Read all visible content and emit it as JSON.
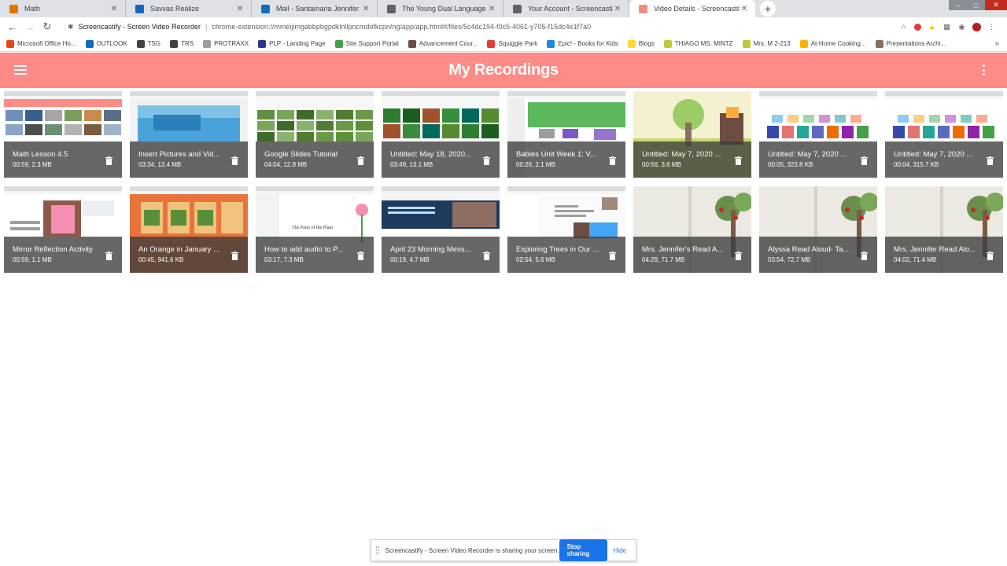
{
  "browser": {
    "tabs": [
      {
        "label": "Math",
        "color": "#e37400",
        "active": false
      },
      {
        "label": "Savvas Realize",
        "color": "#1565c0",
        "active": false
      },
      {
        "label": "Mail - Santamaria Jennifer - Outl",
        "color": "#0f6cbd",
        "active": false
      },
      {
        "label": "The Young Dual Language Learn",
        "color": "#5f6368",
        "active": false
      },
      {
        "label": "Your Account - Screencastify",
        "color": "#5f6368",
        "active": false
      },
      {
        "label": "Video Details - Screencastify",
        "color": "#f28b82",
        "active": true
      }
    ],
    "omnibox": {
      "site": "Screencastify - Screen Video Recorder",
      "url": "chrome-extension://mmeijimgabbpbgpdklnllpncmdofkcpn/ng/app/app.html#/files/5c4dc194-f0c5-4061-y705-f15dc4e1f7a0"
    },
    "bookmarks": [
      {
        "label": "Microsoft Office Ho...",
        "color": "#e64a19"
      },
      {
        "label": "OUTLOOK",
        "color": "#0f6cbd"
      },
      {
        "label": "TSG",
        "color": "#424242"
      },
      {
        "label": "TRS",
        "color": "#424242"
      },
      {
        "label": "PROTRAXX",
        "color": "#9e9e9e"
      },
      {
        "label": "PLP - Landing Page",
        "color": "#283593"
      },
      {
        "label": "Site Support Portal",
        "color": "#43a047"
      },
      {
        "label": "Advancement Cour...",
        "color": "#6d4c41"
      },
      {
        "label": "Squiggle Park",
        "color": "#e53935"
      },
      {
        "label": "Epic! - Books for Kids",
        "color": "#1e88e5"
      },
      {
        "label": "Blogs",
        "color": "#fdd835"
      },
      {
        "label": "THIAGO MS. MINTZ",
        "color": "#c0ca33"
      },
      {
        "label": "Mrs. M 2-213",
        "color": "#c0ca33"
      },
      {
        "label": "At-Home Cooking...",
        "color": "#ffb300"
      },
      {
        "label": "Presentations Archi...",
        "color": "#8d6e63"
      }
    ]
  },
  "app": {
    "title": "My Recordings",
    "accent": "#fe8b86"
  },
  "recordings": [
    {
      "title": "Math Lesson 4.5",
      "info": "00:59, 2.3 MB",
      "thumb": "slides-grid"
    },
    {
      "title": "Insert Pictures and Vid...",
      "info": "03:34, 13.4 MB",
      "thumb": "blue-photo"
    },
    {
      "title": "Google Slides Tutorial",
      "info": "04:04, 12.8 MB",
      "thumb": "green-grid"
    },
    {
      "title": "Untitled: May 18, 2020...",
      "info": "03:49, 13.1 MB",
      "thumb": "nature-grid"
    },
    {
      "title": "Babies Unit Week 1: V...",
      "info": "00:26, 2.1 MB",
      "thumb": "vocab-slide"
    },
    {
      "title": "Untitled: May 7, 2020 ...",
      "info": "00:56, 3.6 MB",
      "thumb": "illustration"
    },
    {
      "title": "Untitled: May 7, 2020 ...",
      "info": "00:05, 323.8 KB",
      "thumb": "book-grid"
    },
    {
      "title": "Untitled: May 7, 2020 ...",
      "info": "00:04, 315.7 KB",
      "thumb": "book-grid"
    },
    {
      "title": "Mirror Reflection Activity",
      "info": "00:59, 1.1 MB",
      "thumb": "doc-photo"
    },
    {
      "title": "An Orange in January ...",
      "info": "00:45, 941.6 KB",
      "thumb": "orange-slide"
    },
    {
      "title": "How to add audio to P...",
      "info": "03:17, 7.3 MB",
      "thumb": "plant-slide"
    },
    {
      "title": "April 23 Morning Mess...",
      "info": "00:19, 4.7 MB",
      "thumb": "blue-web"
    },
    {
      "title": "Exploring Trees in Our ...",
      "info": "02:54, 5.6 MB",
      "thumb": "tree-doc"
    },
    {
      "title": "Mrs. Jennifer's Read A...",
      "info": "04:29, 71.7 MB",
      "thumb": "book-tree"
    },
    {
      "title": "Alyssa Read Aloud- Ta...",
      "info": "03:54, 72.7 MB",
      "thumb": "book-tree"
    },
    {
      "title": "Mrs. Jennifer Read Alo...",
      "info": "04:02, 71.4 MB",
      "thumb": "book-tree"
    }
  ],
  "sharebar": {
    "message": "Screencastify - Screen Video Recorder is sharing your screen.",
    "stop_label": "Stop sharing",
    "hide_label": "Hide"
  }
}
